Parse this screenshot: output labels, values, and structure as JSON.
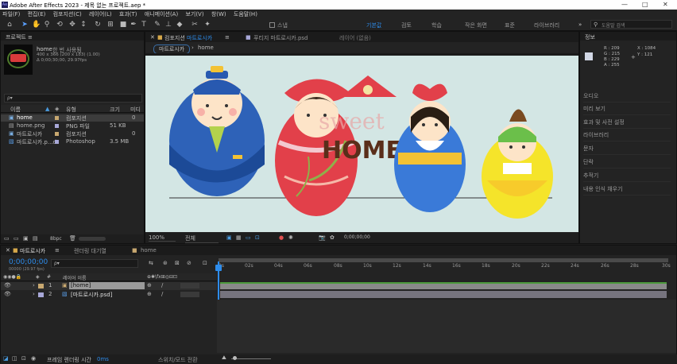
{
  "window": {
    "title": "Adobe After Effects 2023 - 제목 없는 프로젝트.aep *",
    "min": "—",
    "max": "□",
    "close": "✕"
  },
  "menu": [
    "파일(F)",
    "편집(E)",
    "컴포지션(C)",
    "레이어(L)",
    "효과(T)",
    "애니메이션(A)",
    "보기(V)",
    "창(W)",
    "도움말(H)"
  ],
  "toolbar": {
    "snap": "스냅",
    "workspaces": [
      "기본값",
      "검토",
      "학습",
      "작은 화면",
      "표준",
      "라이브러리"
    ],
    "search": "도움말 검색"
  },
  "project": {
    "tab": "프로젝트",
    "comp_name": "home",
    "comp_used": "한 번 사용됨",
    "comp_dims": "400 x 366 (200 x 183) (1.00)",
    "comp_dur": "Δ 0;00;30;00, 29.97fps",
    "search_placeholder": "ρ▾",
    "headers": {
      "name": "이름",
      "type": "유형",
      "size": "크기",
      "frame": "미디"
    },
    "rows": [
      {
        "name": "home",
        "type": "컴포지션",
        "size": "",
        "extra": "0"
      },
      {
        "name": "home.png",
        "type": "PNG 파일",
        "size": "51 KB",
        "extra": ""
      },
      {
        "name": "마트로시카",
        "type": "컴포지션",
        "size": "",
        "extra": "0"
      },
      {
        "name": "마트로시카.p...d",
        "type": "Photoshop",
        "size": "3.5 MB",
        "extra": ""
      }
    ],
    "bpc": "8bpc"
  },
  "comp": {
    "tab_prefix": "컴포지션",
    "tab_name": "마트로시카",
    "footage_tab": "푸티지 마트로시카.psd",
    "layer_tab": "레이어 (없음)",
    "breadcrumb": [
      "마트로시카",
      "home"
    ],
    "zoom": "100%",
    "quality": "전체",
    "time": "0;00;00;00",
    "artwork_text": "HOME",
    "artwork_script": "sweet"
  },
  "info": {
    "tab": "정보",
    "r": "R : 209",
    "g": "G : 215",
    "b": "B : 229",
    "a": "A : 255",
    "x": "X : 1084",
    "y": "Y : 121",
    "items": [
      "오디오",
      "미리 보기",
      "효과 및 사전 설정",
      "라이브러리",
      "문자",
      "단락",
      "추적기",
      "내용 인식 채우기"
    ]
  },
  "timeline": {
    "tab": "마트로시카",
    "render_tab": "렌더링 대기열",
    "home_tab": "home",
    "time": "0;00;00;00",
    "fps": "00000 (29.97 fps)",
    "search": "ρ▾",
    "hdr_num": "#",
    "hdr_name": "레이어 이름",
    "layers": [
      {
        "num": "1",
        "name": "[home]",
        "color": "#c8a870"
      },
      {
        "num": "2",
        "name": "[마트로시카.psd]",
        "color": "#a8a8d8"
      }
    ],
    "ticks": [
      "0s",
      "02s",
      "04s",
      "06s",
      "08s",
      "10s",
      "12s",
      "14s",
      "16s",
      "18s",
      "20s",
      "22s",
      "24s",
      "26s",
      "28s",
      "30s"
    ],
    "footer_label": "프레임 렌더링 시간",
    "footer_value": "0ms",
    "switch_label": "스위치/모드 전환"
  }
}
